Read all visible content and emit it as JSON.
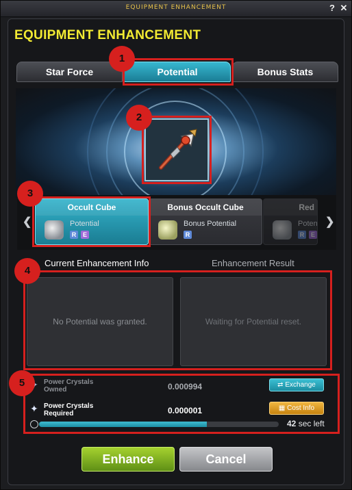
{
  "window": {
    "title": "EQUIPMENT ENHANCEMENT",
    "help_label": "?",
    "close_label": "✕"
  },
  "header": {
    "title": "EQUIPMENT ENHANCEMENT"
  },
  "tabs": [
    {
      "label": "Star Force",
      "active": false
    },
    {
      "label": "Potential",
      "active": true
    },
    {
      "label": "Bonus Stats",
      "active": false
    }
  ],
  "callouts": [
    "1",
    "2",
    "3",
    "4",
    "5"
  ],
  "item": {
    "icon": "weapon-icon"
  },
  "cubes": [
    {
      "name": "Occult Cube",
      "type": "Potential",
      "badges": [
        "R",
        "E"
      ],
      "selected": true
    },
    {
      "name": "Bonus Occult Cube",
      "type": "Bonus Potential",
      "badges": [
        "R"
      ],
      "selected": false
    },
    {
      "name": "Red",
      "type": "Poten",
      "badges": [
        "R",
        "E"
      ],
      "selected": false
    }
  ],
  "nav": {
    "prev": "❮",
    "next": "❯"
  },
  "info": {
    "current_heading": "Current Enhancement Info",
    "result_heading": "Enhancement Result",
    "current_text": "No Potential was granted.",
    "result_text": "Waiting for Potential reset."
  },
  "crystals": {
    "owned_label_1": "Power Crystals",
    "owned_label_2": "Owned",
    "owned_value": "0.000994",
    "required_label_1": "Power Crystals",
    "required_label_2": "Required",
    "required_value": "0.000001",
    "exchange_label": "Exchange",
    "cost_info_label": "Cost Info",
    "timer_value": "42",
    "timer_suffix": "sec left",
    "timer_fraction": 0.7
  },
  "footer": {
    "enhance_label": "Enhance",
    "cancel_label": "Cancel"
  },
  "colors": {
    "accent": "#2ea8c2",
    "title": "#f2ea32",
    "callout": "#d6201e"
  }
}
